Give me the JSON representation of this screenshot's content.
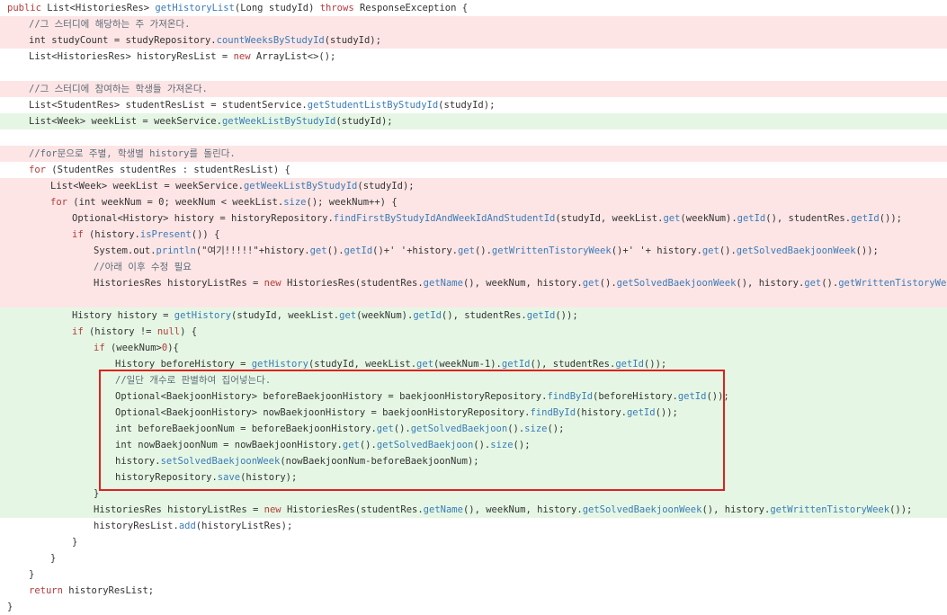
{
  "colors": {
    "removed_bg": "#fde5e5",
    "added_bg": "#e5f7e4",
    "keyword": "#b83a3a",
    "method": "#3a7bb8",
    "comment": "#5d6c79",
    "highlight_border": "#e02020"
  },
  "lines": [
    {
      "type": "plain",
      "indent": 0,
      "tokens": [
        [
          "kw",
          "public "
        ],
        [
          "tx",
          "List<HistoriesRes> "
        ],
        [
          "fn",
          "getHistoryList"
        ],
        [
          "tx",
          "(Long studyId) "
        ],
        [
          "kw",
          "throws "
        ],
        [
          "tx",
          "ResponseException {"
        ]
      ]
    },
    {
      "type": "del",
      "indent": 1,
      "tokens": [
        [
          "cm",
          "//그 스터디에 해당하는 주 가져온다."
        ]
      ]
    },
    {
      "type": "del",
      "indent": 1,
      "tokens": [
        [
          "tx",
          "int studyCount = studyRepository."
        ],
        [
          "fn",
          "countWeeksByStudyId"
        ],
        [
          "tx",
          "(studyId);"
        ]
      ]
    },
    {
      "type": "plain",
      "indent": 1,
      "tokens": [
        [
          "tx",
          "List<HistoriesRes> historyResList = "
        ],
        [
          "kw",
          "new "
        ],
        [
          "tx",
          "ArrayList<>();"
        ]
      ]
    },
    {
      "type": "plain",
      "indent": 0,
      "tokens": []
    },
    {
      "type": "del",
      "indent": 1,
      "tokens": [
        [
          "cm",
          "//그 스터디에 참여하는 학생들 가져온다."
        ]
      ]
    },
    {
      "type": "plain",
      "indent": 1,
      "tokens": [
        [
          "tx",
          "List<StudentRes> studentResList = studentService."
        ],
        [
          "fn",
          "getStudentListByStudyId"
        ],
        [
          "tx",
          "(studyId);"
        ]
      ]
    },
    {
      "type": "add",
      "indent": 1,
      "tokens": [
        [
          "tx",
          "List<Week> weekList = weekService."
        ],
        [
          "fn",
          "getWeekListByStudyId"
        ],
        [
          "tx",
          "(studyId);"
        ]
      ]
    },
    {
      "type": "plain",
      "indent": 0,
      "tokens": []
    },
    {
      "type": "del",
      "indent": 1,
      "tokens": [
        [
          "cm",
          "//for문으로 주별, 학생별 history를 돌린다."
        ]
      ]
    },
    {
      "type": "plain",
      "indent": 1,
      "tokens": [
        [
          "kw",
          "for "
        ],
        [
          "tx",
          "(StudentRes studentRes : studentResList) {"
        ]
      ]
    },
    {
      "type": "del",
      "indent": 2,
      "tokens": [
        [
          "tx",
          "List<Week> weekList = weekService."
        ],
        [
          "fn",
          "getWeekListByStudyId"
        ],
        [
          "tx",
          "(studyId);"
        ]
      ]
    },
    {
      "type": "del",
      "indent": 2,
      "tokens": [
        [
          "kw",
          "for "
        ],
        [
          "tx",
          "(int weekNum = 0; weekNum < weekList."
        ],
        [
          "fn",
          "size"
        ],
        [
          "tx",
          "(); weekNum++) {"
        ]
      ]
    },
    {
      "type": "del",
      "indent": 3,
      "tokens": [
        [
          "tx",
          "Optional<History> history = historyRepository."
        ],
        [
          "fn",
          "findFirstByStudyIdAndWeekIdAndStudentId"
        ],
        [
          "tx",
          "(studyId, weekList."
        ],
        [
          "fn",
          "get"
        ],
        [
          "tx",
          "(weekNum)."
        ],
        [
          "fn",
          "getId"
        ],
        [
          "tx",
          "(), studentRes."
        ],
        [
          "fn",
          "getId"
        ],
        [
          "tx",
          "());"
        ]
      ]
    },
    {
      "type": "del",
      "indent": 3,
      "tokens": [
        [
          "kw",
          "if "
        ],
        [
          "tx",
          "(history."
        ],
        [
          "fn",
          "isPresent"
        ],
        [
          "tx",
          "()) {"
        ]
      ]
    },
    {
      "type": "del",
      "indent": 4,
      "tokens": [
        [
          "tx",
          "System.out."
        ],
        [
          "fn",
          "println"
        ],
        [
          "tx",
          "(\"여기!!!!!\"+history."
        ],
        [
          "fn",
          "get"
        ],
        [
          "tx",
          "()."
        ],
        [
          "fn",
          "getId"
        ],
        [
          "tx",
          "()+' '+history."
        ],
        [
          "fn",
          "get"
        ],
        [
          "tx",
          "()."
        ],
        [
          "fn",
          "getWrittenTistoryWeek"
        ],
        [
          "tx",
          "()+' '+ history."
        ],
        [
          "fn",
          "get"
        ],
        [
          "tx",
          "()."
        ],
        [
          "fn",
          "getSolvedBaekjoonWeek"
        ],
        [
          "tx",
          "());"
        ]
      ]
    },
    {
      "type": "del",
      "indent": 4,
      "tokens": [
        [
          "cm",
          "//아래 이후 수정 필요"
        ]
      ]
    },
    {
      "type": "del",
      "indent": 4,
      "tokens": [
        [
          "tx",
          "HistoriesRes historyListRes = "
        ],
        [
          "kw",
          "new "
        ],
        [
          "tx",
          "HistoriesRes(studentRes."
        ],
        [
          "fn",
          "getName"
        ],
        [
          "tx",
          "(), weekNum, history."
        ],
        [
          "fn",
          "get"
        ],
        [
          "tx",
          "()."
        ],
        [
          "fn",
          "getSolvedBaekjoonWeek"
        ],
        [
          "tx",
          "(), history."
        ],
        [
          "fn",
          "get"
        ],
        [
          "tx",
          "()."
        ],
        [
          "fn",
          "getWrittenTistoryWeek"
        ],
        [
          "tx",
          "());"
        ]
      ]
    },
    {
      "type": "del",
      "indent": 0,
      "tokens": []
    },
    {
      "type": "add",
      "indent": 3,
      "tokens": [
        [
          "tx",
          "History history = "
        ],
        [
          "fn",
          "getHistory"
        ],
        [
          "tx",
          "(studyId, weekList."
        ],
        [
          "fn",
          "get"
        ],
        [
          "tx",
          "(weekNum)."
        ],
        [
          "fn",
          "getId"
        ],
        [
          "tx",
          "(), studentRes."
        ],
        [
          "fn",
          "getId"
        ],
        [
          "tx",
          "());"
        ]
      ]
    },
    {
      "type": "add",
      "indent": 3,
      "tokens": [
        [
          "kw",
          "if "
        ],
        [
          "tx",
          "(history != "
        ],
        [
          "kw",
          "null"
        ],
        [
          "tx",
          ") {"
        ]
      ]
    },
    {
      "type": "add",
      "indent": 4,
      "tokens": [
        [
          "kw",
          "if "
        ],
        [
          "tx",
          "(weekNum>"
        ],
        [
          "kw",
          "0"
        ],
        [
          "tx",
          "){"
        ]
      ]
    },
    {
      "type": "add",
      "indent": 5,
      "tokens": [
        [
          "tx",
          "History beforeHistory = "
        ],
        [
          "fn",
          "getHistory"
        ],
        [
          "tx",
          "(studyId, weekList."
        ],
        [
          "fn",
          "get"
        ],
        [
          "tx",
          "(weekNum-1)."
        ],
        [
          "fn",
          "getId"
        ],
        [
          "tx",
          "(), studentRes."
        ],
        [
          "fn",
          "getId"
        ],
        [
          "tx",
          "());"
        ]
      ]
    },
    {
      "type": "add",
      "indent": 5,
      "tokens": [
        [
          "cm",
          "//일단 개수로 판별하여 집어넣는다."
        ]
      ]
    },
    {
      "type": "add",
      "indent": 5,
      "tokens": [
        [
          "tx",
          "Optional<BaekjoonHistory> beforeBaekjoonHistory = baekjoonHistoryRepository."
        ],
        [
          "fn",
          "findById"
        ],
        [
          "tx",
          "(beforeHistory."
        ],
        [
          "fn",
          "getId"
        ],
        [
          "tx",
          "());"
        ]
      ]
    },
    {
      "type": "add",
      "indent": 5,
      "tokens": [
        [
          "tx",
          "Optional<BaekjoonHistory> nowBaekjoonHistory = baekjoonHistoryRepository."
        ],
        [
          "fn",
          "findById"
        ],
        [
          "tx",
          "(history."
        ],
        [
          "fn",
          "getId"
        ],
        [
          "tx",
          "());"
        ]
      ]
    },
    {
      "type": "add",
      "indent": 5,
      "tokens": [
        [
          "tx",
          "int beforeBaekjoonNum = beforeBaekjoonHistory."
        ],
        [
          "fn",
          "get"
        ],
        [
          "tx",
          "()."
        ],
        [
          "fn",
          "getSolvedBaekjoon"
        ],
        [
          "tx",
          "()."
        ],
        [
          "fn",
          "size"
        ],
        [
          "tx",
          "();"
        ]
      ]
    },
    {
      "type": "add",
      "indent": 5,
      "tokens": [
        [
          "tx",
          "int nowBaekjoonNum = nowBaekjoonHistory."
        ],
        [
          "fn",
          "get"
        ],
        [
          "tx",
          "()."
        ],
        [
          "fn",
          "getSolvedBaekjoon"
        ],
        [
          "tx",
          "()."
        ],
        [
          "fn",
          "size"
        ],
        [
          "tx",
          "();"
        ]
      ]
    },
    {
      "type": "add",
      "indent": 5,
      "tokens": [
        [
          "tx",
          "history."
        ],
        [
          "fn",
          "setSolvedBaekjoonWeek"
        ],
        [
          "tx",
          "(nowBaekjoonNum-beforeBaekjoonNum);"
        ]
      ]
    },
    {
      "type": "add",
      "indent": 5,
      "tokens": [
        [
          "tx",
          "historyRepository."
        ],
        [
          "fn",
          "save"
        ],
        [
          "tx",
          "(history);"
        ]
      ]
    },
    {
      "type": "add",
      "indent": 4,
      "tokens": [
        [
          "tx",
          "}"
        ]
      ]
    },
    {
      "type": "add",
      "indent": 4,
      "tokens": [
        [
          "tx",
          "HistoriesRes historyListRes = "
        ],
        [
          "kw",
          "new "
        ],
        [
          "tx",
          "HistoriesRes(studentRes."
        ],
        [
          "fn",
          "getName"
        ],
        [
          "tx",
          "(), weekNum, history."
        ],
        [
          "fn",
          "getSolvedBaekjoonWeek"
        ],
        [
          "tx",
          "(), history."
        ],
        [
          "fn",
          "getWrittenTistoryWeek"
        ],
        [
          "tx",
          "());"
        ]
      ]
    },
    {
      "type": "plain",
      "indent": 4,
      "tokens": [
        [
          "tx",
          "historyResList."
        ],
        [
          "fn",
          "add"
        ],
        [
          "tx",
          "(historyListRes);"
        ]
      ]
    },
    {
      "type": "plain",
      "indent": 3,
      "tokens": [
        [
          "tx",
          "}"
        ]
      ]
    },
    {
      "type": "plain",
      "indent": 2,
      "tokens": [
        [
          "tx",
          "}"
        ]
      ]
    },
    {
      "type": "plain",
      "indent": 1,
      "tokens": [
        [
          "tx",
          "}"
        ]
      ]
    },
    {
      "type": "plain",
      "indent": 1,
      "tokens": [
        [
          "kw",
          "return "
        ],
        [
          "tx",
          "historyResList;"
        ]
      ]
    },
    {
      "type": "plain",
      "indent": 0,
      "tokens": [
        [
          "tx",
          "}"
        ]
      ]
    }
  ]
}
